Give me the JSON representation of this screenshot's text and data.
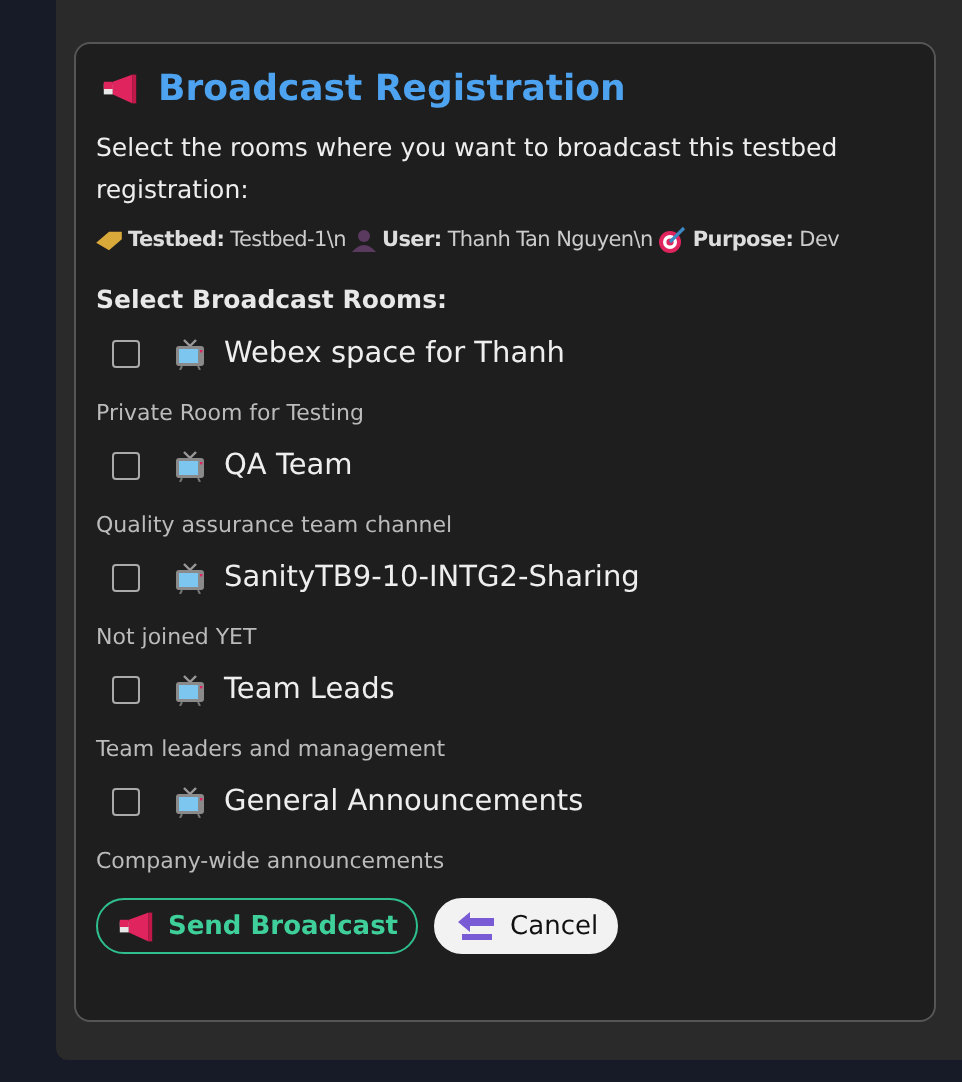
{
  "dialog": {
    "title": "Broadcast Registration",
    "intro": "Select the rooms where you want to broadcast this testbed registration:",
    "details": [
      {
        "kind": "tag",
        "text": "**Testbed:** Testbed-1\\n"
      },
      {
        "kind": "person",
        "text": "**User:** Thanh Tan Nguyen\\n"
      },
      {
        "kind": "target",
        "text": "**Purpose:** Dev"
      }
    ],
    "rooms_heading": "Select Broadcast Rooms:",
    "rooms": [
      {
        "name": "Webex space for Thanh",
        "description": "Private Room for Testing",
        "checked": false
      },
      {
        "name": "QA Team",
        "description": "Quality assurance team channel",
        "checked": false
      },
      {
        "name": "SanityTB9-10-INTG2-Sharing",
        "description": "Not joined YET",
        "checked": false
      },
      {
        "name": "Team Leads",
        "description": "Team leaders and management",
        "checked": false
      },
      {
        "name": "General Announcements",
        "description": "Company-wide announcements",
        "checked": false
      }
    ],
    "buttons": [
      {
        "kind": "primary",
        "label": "Send Broadcast"
      },
      {
        "kind": "secondary",
        "label": "Cancel"
      }
    ]
  }
}
